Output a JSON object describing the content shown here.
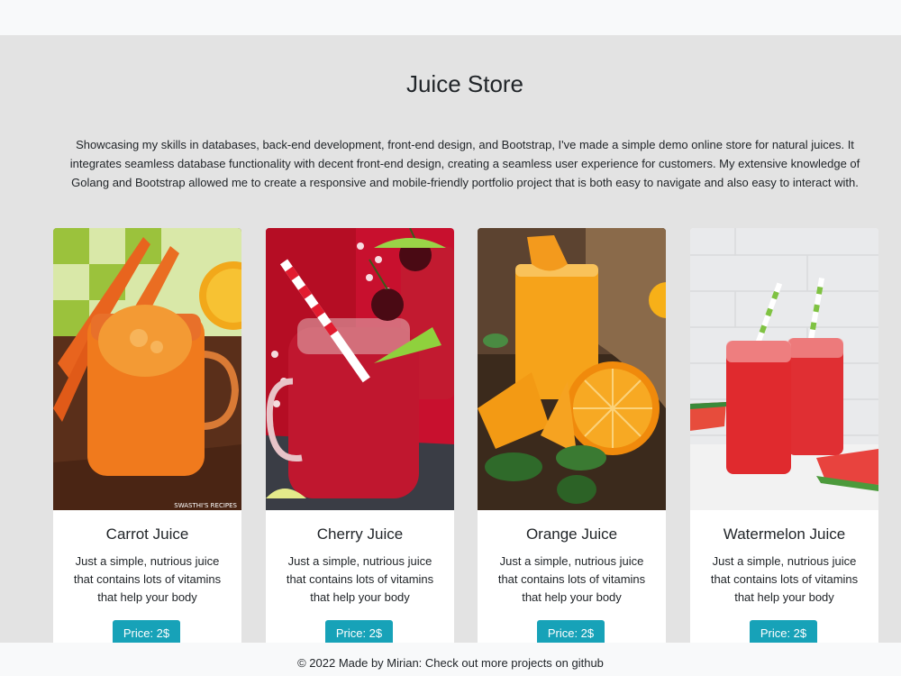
{
  "page": {
    "title": "Juice Store",
    "description": "Showcasing my skills in databases, back-end development, front-end design, and Bootstrap, I've made a simple demo online store for natural juices. It integrates seamless database functionality with decent front-end design, creating a seamless user experience for customers. My extensive knowledge of Golang and Bootstrap allowed me to create a responsive and mobile-friendly portfolio project that is both easy to navigate and also easy to interact with."
  },
  "products": [
    {
      "name": "Carrot Juice",
      "description": "Just a simple, nutrious juice that contains lots of vitamins that help your body",
      "price": "Price: 2$",
      "image_watermark": "SWASTHI'S RECIPES"
    },
    {
      "name": "Cherry Juice",
      "description": "Just a simple, nutrious juice that contains lots of vitamins that help your body",
      "price": "Price: 2$"
    },
    {
      "name": "Orange Juice",
      "description": "Just a simple, nutrious juice that contains lots of vitamins that help your body",
      "price": "Price: 2$"
    },
    {
      "name": "Watermelon Juice",
      "description": "Just a simple, nutrious juice that contains lots of vitamins that help your body",
      "price": "Price: 2$"
    }
  ],
  "footer": {
    "text": "© 2022 Made by Mirian: Check out more projects on github"
  },
  "colors": {
    "background": "#e3e3e3",
    "bar": "#f8f9fa",
    "button": "#17a2b8"
  }
}
